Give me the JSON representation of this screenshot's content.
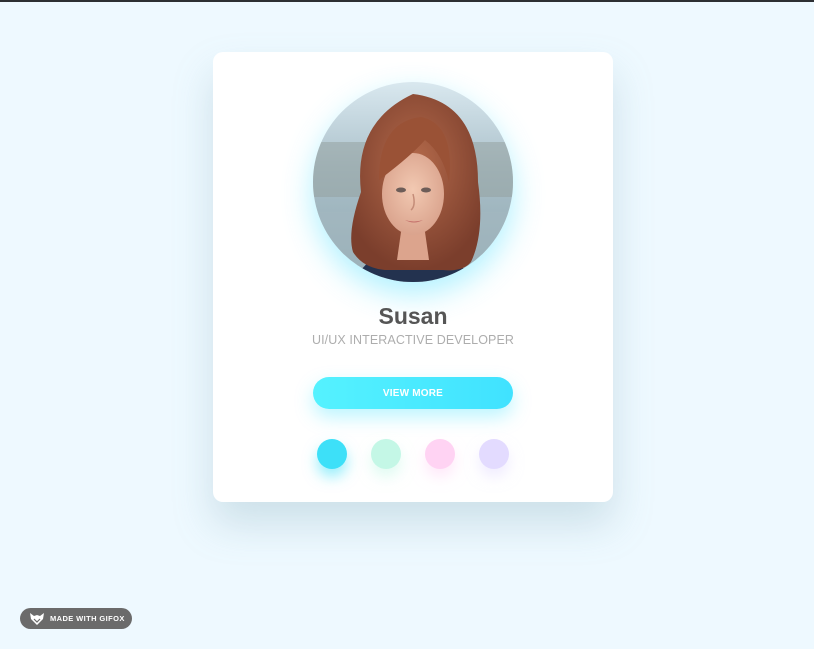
{
  "profile": {
    "name": "Susan",
    "role": "UI/UX INTERACTIVE DEVELOPER",
    "avatar_icon": "portrait-photo"
  },
  "actions": {
    "view_more_label": "VIEW MORE"
  },
  "color_dots": [
    {
      "color": "#3de0f8",
      "name": "cyan"
    },
    {
      "color": "#c4f7e6",
      "name": "mint"
    },
    {
      "color": "#ffd3f3",
      "name": "pink"
    },
    {
      "color": "#e3dbff",
      "name": "lavender"
    }
  ],
  "badge": {
    "text": "MADE WITH GIFOX",
    "icon": "fox-icon"
  },
  "colors": {
    "background": "#eef9ff",
    "card": "#ffffff",
    "accent": "#40e2ff",
    "name_text": "#555555",
    "role_text": "#adadad"
  }
}
